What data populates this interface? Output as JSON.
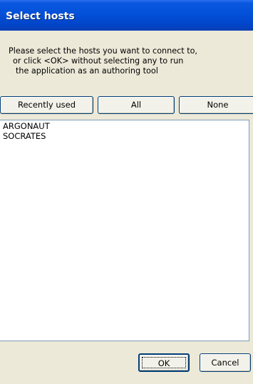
{
  "window": {
    "title": "Select hosts"
  },
  "instructions": [
    "Please select the hosts you want to connect to,",
    "or click <OK> without selecting any to run",
    "the application as an authoring tool"
  ],
  "filter_buttons": {
    "recently_used": "Recently used",
    "all": "All",
    "none": "None"
  },
  "hosts": [
    "ARGONAUT",
    "SOCRATES"
  ],
  "dialog_buttons": {
    "ok": "OK",
    "cancel": "Cancel"
  },
  "colors": {
    "title_bar": "#0350d9",
    "dialog_background": "#ece9d8",
    "button_border": "#003c74"
  }
}
